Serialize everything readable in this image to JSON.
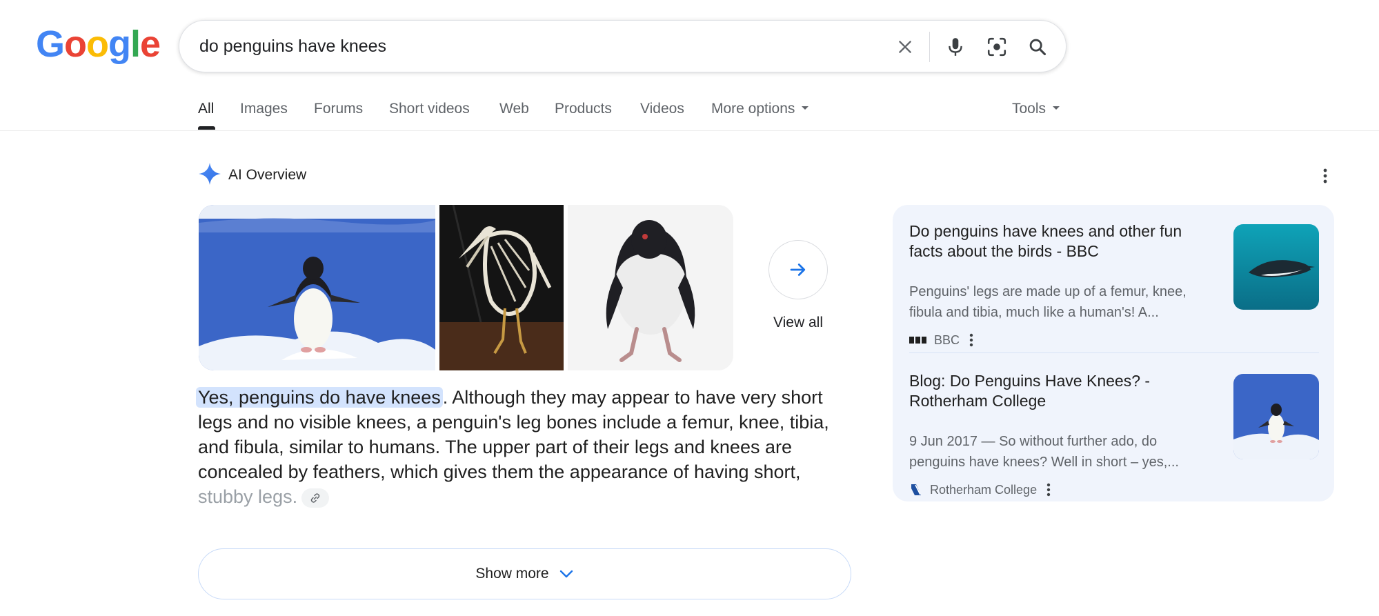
{
  "logo": {
    "letters": [
      "G",
      "o",
      "o",
      "g",
      "l",
      "e"
    ],
    "colors": [
      "#4285F4",
      "#EA4335",
      "#FBBC05",
      "#4285F4",
      "#34A853",
      "#EA4335"
    ]
  },
  "search": {
    "query": "do penguins have knees",
    "icons": [
      "close-icon",
      "microphone-icon",
      "lens-icon",
      "search-icon"
    ]
  },
  "tabs": [
    {
      "label": "All",
      "active": true
    },
    {
      "label": "Images"
    },
    {
      "label": "Forums"
    },
    {
      "label": "Short videos"
    },
    {
      "label": "Web"
    },
    {
      "label": "Products"
    },
    {
      "label": "Videos"
    },
    {
      "label": "More options",
      "dropdown": true
    }
  ],
  "tools": {
    "label": "Tools"
  },
  "ai_overview": {
    "title": "AI Overview",
    "view_all": "View all",
    "answer_highlight": "Yes, penguins do have knees",
    "answer_rest": ". Although they may appear to have very short legs and no visible knees, a penguin's leg bones include a femur, knee, tibia, and fibula, similar to humans. The upper part of their legs and knees are concealed by feathers, which gives them the appearance of having short,",
    "answer_fade": "stubby legs.",
    "show_more": "Show more"
  },
  "sources": [
    {
      "title": "Do penguins have knees and other fun facts about the birds - BBC",
      "snippet": "Penguins' legs are made up of a femur, knee, fibula and tibia, much like a human's! A...",
      "site": "BBC"
    },
    {
      "title": "Blog: Do Penguins Have Knees? - Rotherham College",
      "snippet": "9 Jun 2017 — So without further ado, do penguins have knees? Well in short – yes,...",
      "site": "Rotherham College"
    }
  ],
  "colors": {
    "accent_blue": "#1a73e8",
    "highlight": "#d3e3fd",
    "panel_bg": "#f0f4fc"
  }
}
